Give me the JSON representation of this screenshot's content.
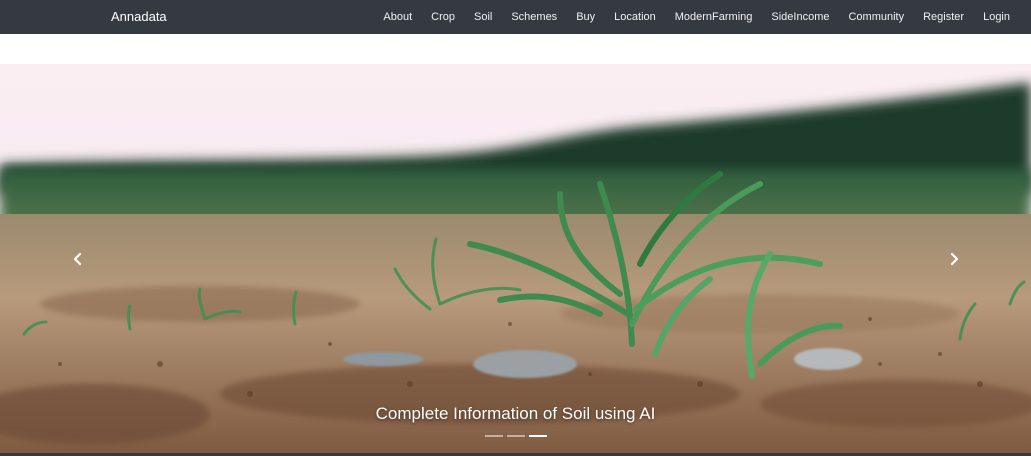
{
  "navbar": {
    "brand": "Annadata",
    "links": [
      {
        "label": "About"
      },
      {
        "label": "Crop"
      },
      {
        "label": "Soil"
      },
      {
        "label": "Schemes"
      },
      {
        "label": "Buy"
      },
      {
        "label": "Location"
      },
      {
        "label": "ModernFarming"
      },
      {
        "label": "SideIncome"
      },
      {
        "label": "Community"
      },
      {
        "label": "Register"
      },
      {
        "label": "Login"
      }
    ]
  },
  "carousel": {
    "caption": "Complete Information of Soil using AI",
    "slide_count": 3,
    "active_index": 2,
    "prev_icon": "chevron-left-icon",
    "next_icon": "chevron-right-icon"
  },
  "colors": {
    "navbar_bg": "#343a40",
    "sky": "#f7e9ee",
    "soil": "#a27c5e",
    "sprout": "#3f8a4e"
  }
}
